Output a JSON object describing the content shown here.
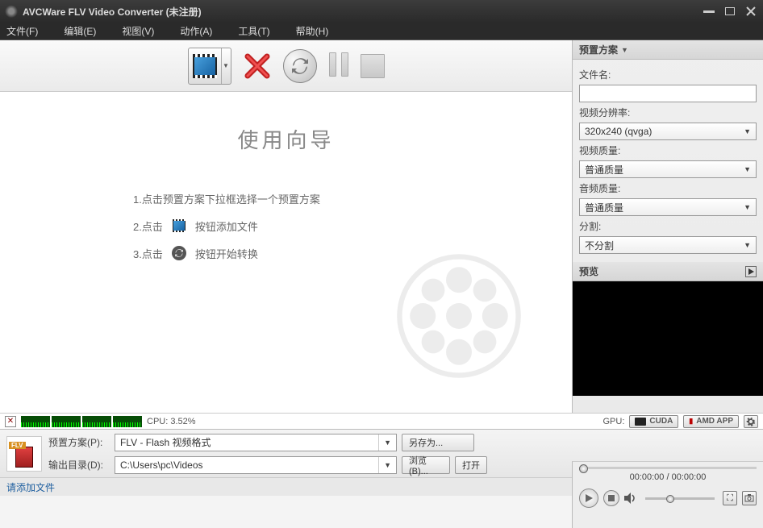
{
  "title": "AVCWare FLV Video Converter (未注册)",
  "menu": {
    "file": "文件(F)",
    "edit": "编辑(E)",
    "view": "视图(V)",
    "action": "动作(A)",
    "tool": "工具(T)",
    "help": "帮助(H)"
  },
  "wizard": {
    "title": "使用向导",
    "step1": "1.点击预置方案下拉框选择一个预置方案",
    "step2a": "2.点击",
    "step2b": "按钮添加文件",
    "step3a": "3.点击",
    "step3b": "按钮开始转换"
  },
  "panel": {
    "preset_header": "预置方案",
    "filename_label": "文件名:",
    "filename_value": "",
    "resolution_label": "视频分辨率:",
    "resolution_value": "320x240 (qvga)",
    "vq_label": "视频质量:",
    "vq_value": "普通质量",
    "aq_label": "音频质量:",
    "aq_value": "普通质量",
    "split_label": "分割:",
    "split_value": "不分割",
    "preview_header": "预览"
  },
  "status": {
    "cpu_label": "CPU: 3.52%",
    "gpu_label": "GPU:",
    "cuda": "CUDA",
    "amd": "AMD APP"
  },
  "bottom": {
    "preset_label": "预置方案(P):",
    "preset_value": "FLV - Flash 视频格式",
    "saveas": "另存为...",
    "output_label": "输出目录(D):",
    "output_value": "C:\\Users\\pc\\Videos",
    "browse": "浏览(B)...",
    "open": "打开"
  },
  "footer": {
    "hint": "请添加文件"
  },
  "preview": {
    "time": "00:00:00 / 00:00:00"
  }
}
